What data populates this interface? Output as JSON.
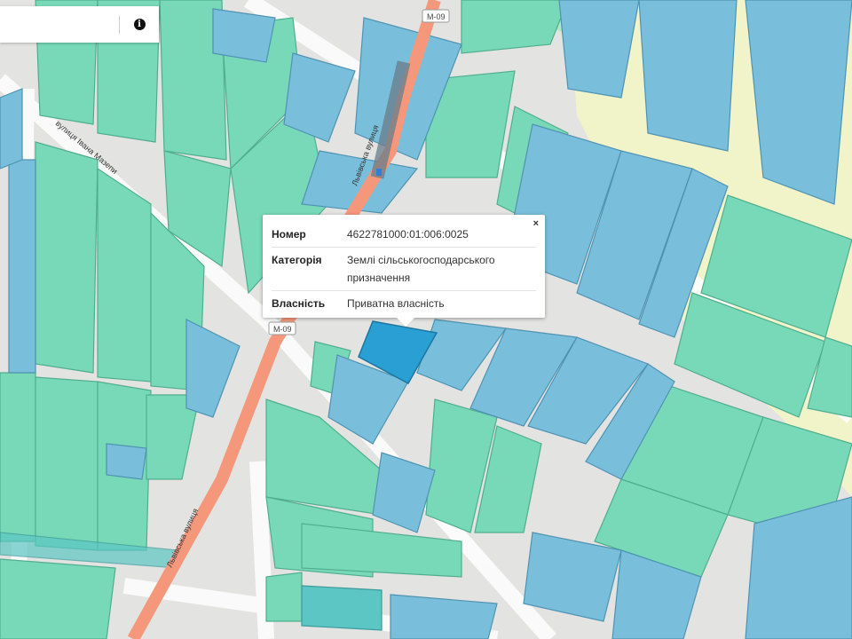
{
  "search": {
    "value": "",
    "placeholder": ""
  },
  "info_button": {
    "icon": "info-icon",
    "glyph": "i"
  },
  "popup": {
    "close_glyph": "×",
    "rows": [
      {
        "key": "Номер",
        "value": "4622781000:01:006:0025"
      },
      {
        "key": "Категорія",
        "value": "Землі сільськогосподарського призначення"
      },
      {
        "key": "Власність",
        "value": "Приватна власність"
      }
    ]
  },
  "map": {
    "road_shields": [
      "M-09",
      "M-09"
    ],
    "street_labels": [
      "Львівська вулиця",
      "Львівська вулиця",
      "вулиця Івана Мазепи"
    ],
    "colors": {
      "agricultural": "#78d9b8",
      "private": "#79bfdc",
      "selected": "#2a9fd3",
      "highway": "#f4977a",
      "yellow_zone": "#f1f3c9"
    }
  }
}
